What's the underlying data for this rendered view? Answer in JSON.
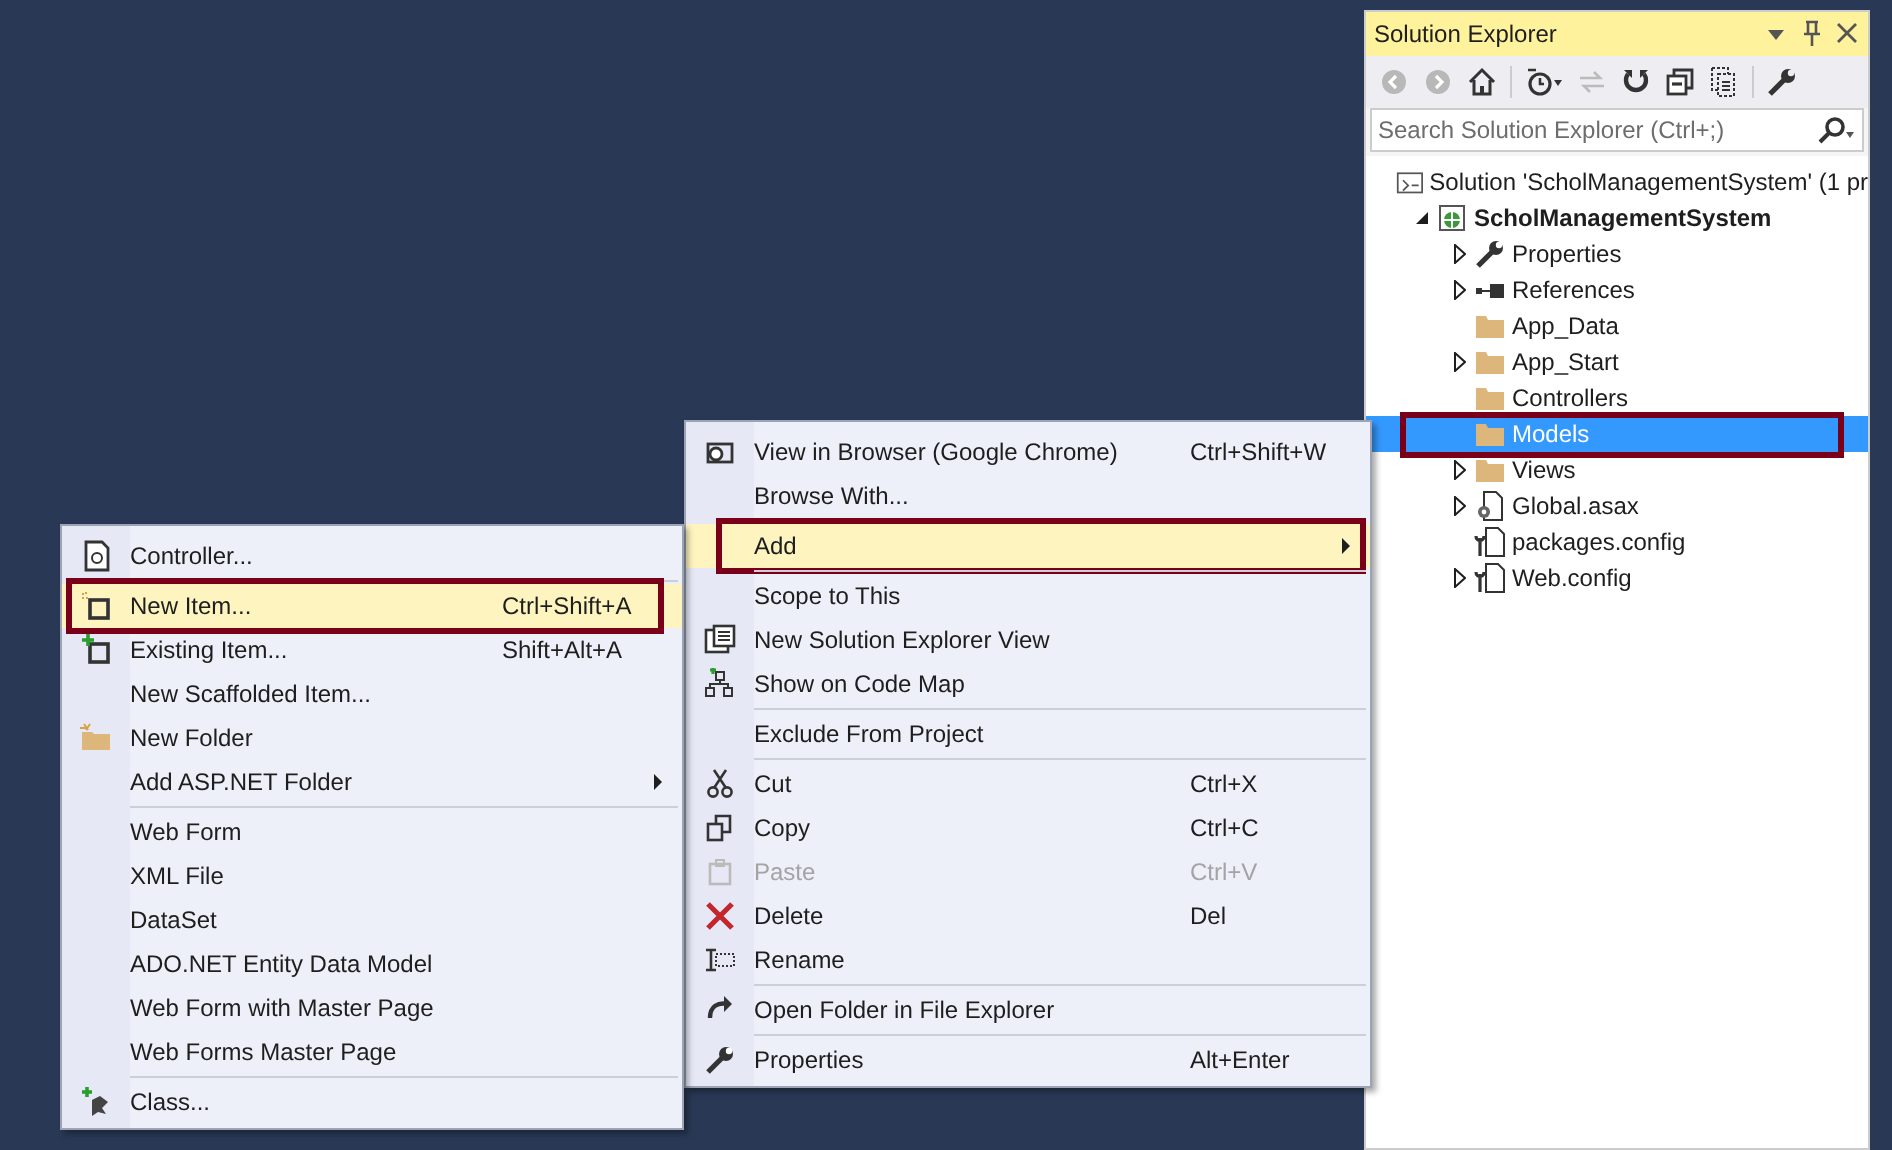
{
  "explorer": {
    "title": "Solution Explorer",
    "search": {
      "placeholder": "Search Solution Explorer (Ctrl+;)"
    },
    "tree": [
      {
        "label": "Solution 'ScholManagementSystem' (1 pr",
        "kind": "solution",
        "bold": false,
        "selected": false,
        "highlighted": false,
        "children": [
          {
            "label": "ScholManagementSystem",
            "kind": "project",
            "bold": true,
            "expanded": true,
            "selected": false,
            "highlighted": false,
            "children": [
              {
                "label": "Properties",
                "kind": "wrench",
                "bold": false,
                "expanded": false,
                "selected": false,
                "highlighted": false
              },
              {
                "label": "References",
                "kind": "references",
                "bold": false,
                "expanded": false,
                "selected": false,
                "highlighted": false
              },
              {
                "label": "App_Data",
                "kind": "folder",
                "bold": false,
                "selected": false,
                "highlighted": false
              },
              {
                "label": "App_Start",
                "kind": "folder",
                "bold": false,
                "expanded": false,
                "selected": false,
                "highlighted": false
              },
              {
                "label": "Controllers",
                "kind": "folder",
                "bold": false,
                "selected": false,
                "highlighted": false
              },
              {
                "label": "Models",
                "kind": "folder",
                "bold": false,
                "selected": true,
                "highlighted": true
              },
              {
                "label": "Views",
                "kind": "folder",
                "bold": false,
                "expanded": false,
                "selected": false,
                "highlighted": false
              },
              {
                "label": "Global.asax",
                "kind": "asax",
                "bold": false,
                "expanded": false,
                "selected": false,
                "highlighted": false
              },
              {
                "label": "packages.config",
                "kind": "config",
                "bold": false,
                "selected": false,
                "highlighted": false
              },
              {
                "label": "Web.config",
                "kind": "config",
                "bold": false,
                "expanded": false,
                "selected": false,
                "highlighted": false
              }
            ]
          }
        ]
      }
    ]
  },
  "menus": [
    {
      "items": [
        {
          "kind": "browser",
          "label": "View in Browser (Google Chrome)",
          "shortcut": "Ctrl+Shift+W",
          "selected": false,
          "highlighted": false,
          "disabled": false,
          "submenu": false
        },
        {
          "kind": "item",
          "label": "Browse With...",
          "selected": false,
          "highlighted": false,
          "disabled": false,
          "submenu": false
        },
        {
          "kind": "separator"
        },
        {
          "kind": "item",
          "label": "Add",
          "selected": true,
          "highlighted": true,
          "disabled": false,
          "submenu": true
        },
        {
          "kind": "separator"
        },
        {
          "kind": "item",
          "label": "Scope to This",
          "selected": false,
          "highlighted": false,
          "disabled": false,
          "submenu": false
        },
        {
          "kind": "newview",
          "label": "New Solution Explorer View",
          "selected": false,
          "highlighted": false,
          "disabled": false,
          "submenu": false
        },
        {
          "kind": "codemap",
          "label": "Show on Code Map",
          "selected": false,
          "highlighted": false,
          "disabled": false,
          "submenu": false
        },
        {
          "kind": "separator"
        },
        {
          "kind": "item",
          "label": "Exclude From Project",
          "selected": false,
          "highlighted": false,
          "disabled": false,
          "submenu": false
        },
        {
          "kind": "separator"
        },
        {
          "kind": "cut",
          "label": "Cut",
          "shortcut": "Ctrl+X",
          "selected": false,
          "highlighted": false,
          "disabled": false,
          "submenu": false
        },
        {
          "kind": "copy",
          "label": "Copy",
          "shortcut": "Ctrl+C",
          "selected": false,
          "highlighted": false,
          "disabled": false,
          "submenu": false
        },
        {
          "kind": "paste",
          "label": "Paste",
          "shortcut": "Ctrl+V",
          "selected": false,
          "highlighted": false,
          "disabled": true,
          "submenu": false
        },
        {
          "kind": "delete",
          "label": "Delete",
          "shortcut": "Del",
          "selected": false,
          "highlighted": false,
          "disabled": false,
          "submenu": false
        },
        {
          "kind": "rename",
          "label": "Rename",
          "selected": false,
          "highlighted": false,
          "disabled": false,
          "submenu": false
        },
        {
          "kind": "separator"
        },
        {
          "kind": "openfolder",
          "label": "Open Folder in File Explorer",
          "selected": false,
          "highlighted": false,
          "disabled": false,
          "submenu": false
        },
        {
          "kind": "separator"
        },
        {
          "kind": "wrench",
          "label": "Properties",
          "shortcut": "Alt+Enter",
          "selected": false,
          "highlighted": false,
          "disabled": false,
          "submenu": false
        }
      ]
    },
    {
      "items": [
        {
          "kind": "controller",
          "label": "Controller...",
          "selected": false,
          "highlighted": false,
          "disabled": false,
          "submenu": false
        },
        {
          "kind": "separator"
        },
        {
          "kind": "newitem",
          "label": "New Item...",
          "shortcut": "Ctrl+Shift+A",
          "selected": true,
          "highlighted": true,
          "disabled": false,
          "submenu": false
        },
        {
          "kind": "existingitem",
          "label": "Existing Item...",
          "shortcut": "Shift+Alt+A",
          "selected": false,
          "highlighted": false,
          "disabled": false,
          "submenu": false
        },
        {
          "kind": "item",
          "label": "New Scaffolded Item...",
          "selected": false,
          "highlighted": false,
          "disabled": false,
          "submenu": false
        },
        {
          "kind": "newfolder",
          "label": "New Folder",
          "selected": false,
          "highlighted": false,
          "disabled": false,
          "submenu": false
        },
        {
          "kind": "item",
          "label": "Add ASP.NET Folder",
          "selected": false,
          "highlighted": false,
          "disabled": false,
          "submenu": true
        },
        {
          "kind": "separator"
        },
        {
          "kind": "item",
          "label": "Web Form",
          "selected": false,
          "highlighted": false,
          "disabled": false,
          "submenu": false
        },
        {
          "kind": "item",
          "label": "XML File",
          "selected": false,
          "highlighted": false,
          "disabled": false,
          "submenu": false
        },
        {
          "kind": "item",
          "label": "DataSet",
          "selected": false,
          "highlighted": false,
          "disabled": false,
          "submenu": false
        },
        {
          "kind": "item",
          "label": "ADO.NET Entity Data Model",
          "selected": false,
          "highlighted": false,
          "disabled": false,
          "submenu": false
        },
        {
          "kind": "item",
          "label": "Web Form with Master Page",
          "selected": false,
          "highlighted": false,
          "disabled": false,
          "submenu": false
        },
        {
          "kind": "item",
          "label": "Web Forms Master Page",
          "selected": false,
          "highlighted": false,
          "disabled": false,
          "submenu": false
        },
        {
          "kind": "separator"
        },
        {
          "kind": "class",
          "label": "Class...",
          "selected": false,
          "highlighted": false,
          "disabled": false,
          "submenu": false
        }
      ]
    }
  ]
}
